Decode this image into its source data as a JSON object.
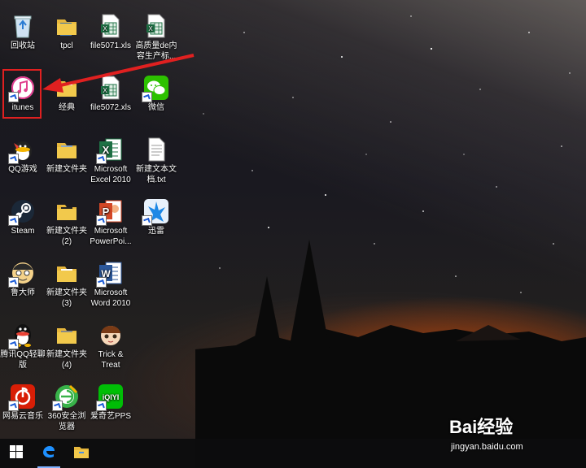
{
  "desktop": {
    "icons": [
      {
        "label": "回收站"
      },
      {
        "label": "tpcl"
      },
      {
        "label": "file5071.xls"
      },
      {
        "label": "高质量de内容生产标..."
      },
      {
        "label": "itunes"
      },
      {
        "label": "经典"
      },
      {
        "label": "file5072.xls"
      },
      {
        "label": "微信"
      },
      {
        "label": "QQ游戏"
      },
      {
        "label": "新建文件夹"
      },
      {
        "label": "Microsoft Excel 2010"
      },
      {
        "label": "新建文本文档.txt"
      },
      {
        "label": "Steam"
      },
      {
        "label": "新建文件夹 (2)"
      },
      {
        "label": "Microsoft PowerPoi..."
      },
      {
        "label": "迅雷"
      },
      {
        "label": "鲁大师"
      },
      {
        "label": "新建文件夹 (3)"
      },
      {
        "label": "Microsoft Word 2010"
      },
      {
        "label": "腾讯QQ轻聊版"
      },
      {
        "label": "新建文件夹 (4)"
      },
      {
        "label": "Trick & Treat"
      },
      {
        "label": "网易云音乐"
      },
      {
        "label": "360安全浏览器"
      },
      {
        "label": "爱奇艺PPS"
      }
    ]
  },
  "taskbar": {
    "buttons": [
      {
        "icon": "windows-start-icon"
      },
      {
        "icon": "edge-browser-icon"
      },
      {
        "icon": "file-explorer-icon"
      }
    ]
  },
  "watermark": {
    "brand": "Bai经验",
    "url": "jingyan.baidu.com"
  },
  "colors": {
    "highlight": "#e02020",
    "taskbar": "#0c0c0e",
    "excel_green": "#1e7145",
    "word_blue": "#2b579a",
    "ppt_orange": "#d24726",
    "folder_yellow": "#f2c94c"
  }
}
